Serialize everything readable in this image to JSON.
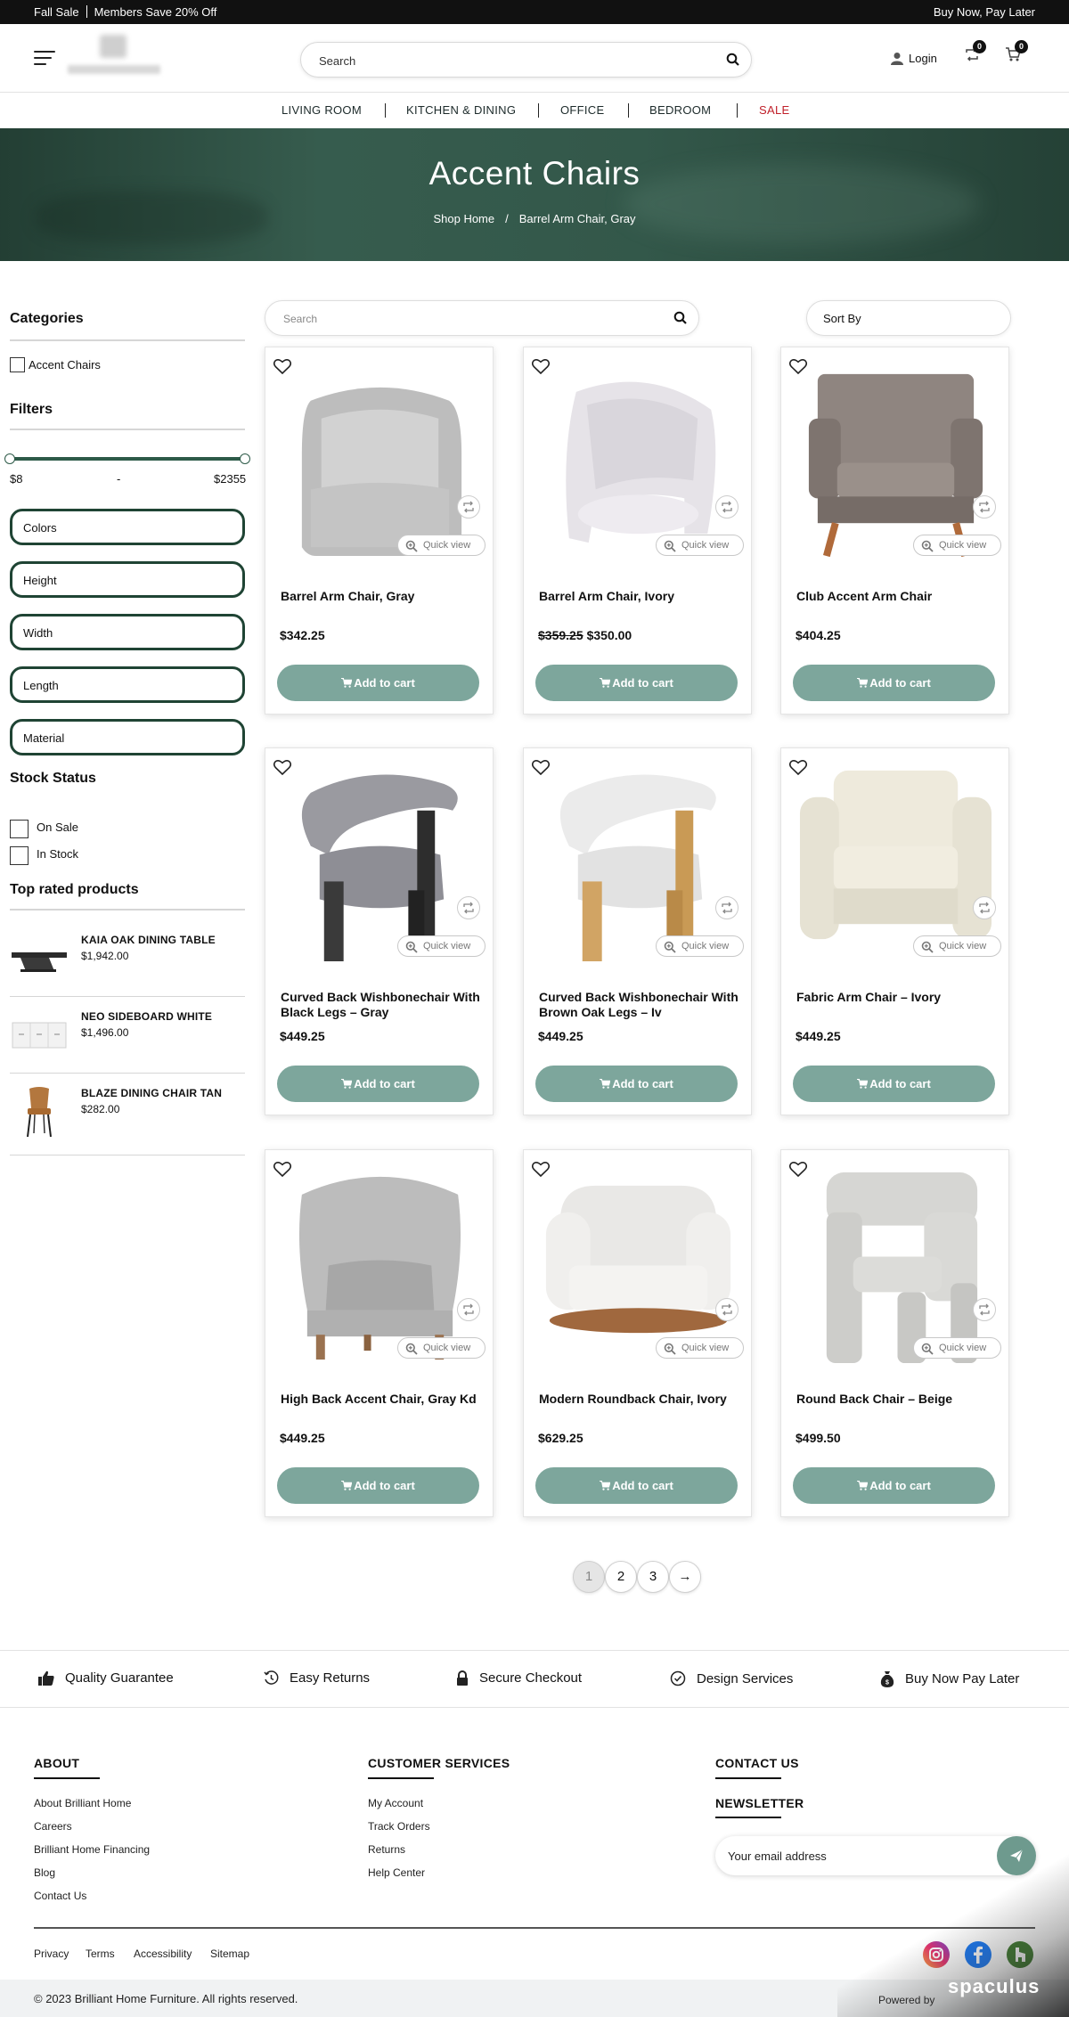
{
  "topbar": {
    "promo": "Fall Sale",
    "members": "Members Save 20% Off",
    "right": "Buy Now, Pay Later"
  },
  "header": {
    "search_placeholder": "Search",
    "login": "Login",
    "compare_count": "0",
    "cart_count": "0"
  },
  "nav": {
    "items": [
      "LIVING ROOM",
      "KITCHEN & DINING",
      "OFFICE",
      "BEDROOM",
      "SALE"
    ]
  },
  "hero": {
    "title": "Accent Chairs",
    "crumb_home": "Shop Home",
    "crumb_sep": "/",
    "crumb_current": "Barrel Arm Chair, Gray"
  },
  "sidebar": {
    "categories_title": "Categories",
    "category": "Accent Chairs",
    "filters_title": "Filters",
    "price_min": "$8",
    "price_dash": "-",
    "price_max": "$2355",
    "price_range_fraction": [
      0,
      1
    ],
    "filters": [
      "Colors",
      "Height",
      "Width",
      "Length",
      "Material"
    ],
    "stock_title": "Stock Status",
    "stock": [
      "On Sale",
      "In Stock"
    ],
    "top_rated_title": "Top rated products",
    "top_rated": [
      {
        "name": "KAIA OAK DINING TABLE",
        "price": "$1,942.00"
      },
      {
        "name": "NEO SIDEBOARD WHITE",
        "price": "$1,496.00"
      },
      {
        "name": "BLAZE DINING CHAIR TAN",
        "price": "$282.00"
      }
    ]
  },
  "toolbar": {
    "search_placeholder": "Search",
    "sort": "Sort By"
  },
  "card_labels": {
    "quick_view": "Quick view",
    "add_to_cart": "Add to cart"
  },
  "products": [
    {
      "name": "Barrel Arm Chair, Gray",
      "old_price": "",
      "price": "$342.25"
    },
    {
      "name": "Barrel Arm Chair, Ivory",
      "old_price": "$359.25",
      "price": "$350.00"
    },
    {
      "name": "Club Accent Arm Chair",
      "old_price": "",
      "price": "$404.25"
    },
    {
      "name": "Curved Back Wishbonechair With Black Legs – Gray",
      "old_price": "",
      "price": "$449.25"
    },
    {
      "name": "Curved Back Wishbonechair With Brown Oak Legs – Iv",
      "old_price": "",
      "price": "$449.25"
    },
    {
      "name": "Fabric Arm Chair – Ivory",
      "old_price": "",
      "price": "$449.25"
    },
    {
      "name": "High Back Accent Chair, Gray Kd",
      "old_price": "",
      "price": "$449.25"
    },
    {
      "name": "Modern Roundback Chair, Ivory",
      "old_price": "",
      "price": "$629.25"
    },
    {
      "name": "Round Back Chair – Beige",
      "old_price": "",
      "price": "$499.50"
    }
  ],
  "pagination": {
    "pages": [
      "1",
      "2",
      "3"
    ],
    "next": "→"
  },
  "features": [
    "Quality Guarantee",
    "Easy Returns",
    "Secure Checkout",
    "Design Services",
    "Buy Now Pay Later"
  ],
  "footer": {
    "about_title": "ABOUT",
    "about_links": [
      "About Brilliant Home",
      "Careers",
      "Brilliant Home Financing",
      "Blog",
      "Contact Us"
    ],
    "cs_title": "CUSTOMER SERVICES",
    "cs_links": [
      "My Account",
      "Track Orders",
      "Returns",
      "Help Center"
    ],
    "contact_title": "CONTACT US",
    "newsletter_title": "NEWSLETTER",
    "newsletter_placeholder": "Your email address",
    "legal": [
      "Privacy",
      "Terms",
      "Accessibility",
      "Sitemap"
    ],
    "copyright": "© 2023 Brilliant Home Furniture. All rights reserved.",
    "powered": "Powered by",
    "watermark": "spaculus"
  },
  "colors": {
    "accent": "#7da69c",
    "hero": "#355a4c",
    "sale": "#c0202a",
    "filter_border": "#1f4434"
  }
}
